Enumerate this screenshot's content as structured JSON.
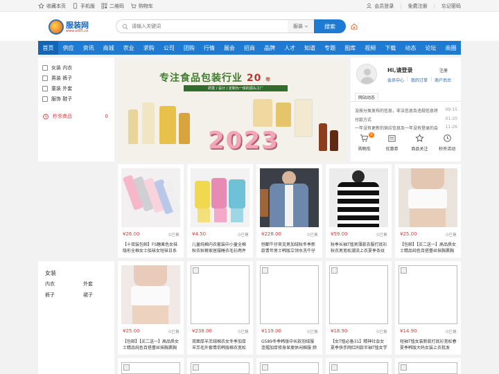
{
  "topbar": {
    "left": [
      {
        "icon": "star-icon",
        "label": "收藏本页"
      },
      {
        "icon": "mobile-icon",
        "label": "手机版"
      },
      {
        "icon": "qrcode-icon",
        "label": "二维码"
      },
      {
        "icon": "cart-icon",
        "label": "购物车"
      }
    ],
    "right": {
      "login_icon": "user-icon",
      "login": "会员登录",
      "register": "免费注册",
      "forgot": "忘记密码"
    }
  },
  "logo": {
    "title": "服装网",
    "url": "www.ef35.cn"
  },
  "search": {
    "placeholder": "请输入关键词",
    "category": "服装",
    "button": "搜索"
  },
  "nav": [
    "首页",
    "供应",
    "资讯",
    "商城",
    "农业",
    "求购",
    "公司",
    "团购",
    "行情",
    "展会",
    "招商",
    "品牌",
    "人才",
    "知道",
    "专题",
    "图库",
    "视频",
    "下载",
    "动态",
    "论坛",
    "商圈"
  ],
  "categories": [
    {
      "label": "女装 内衣"
    },
    {
      "label": "男装 裤子"
    },
    {
      "label": "童装 外套"
    },
    {
      "label": "服饰 鞋子"
    }
  ],
  "flash_sale": {
    "label": "秒杀商品",
    "count": "0"
  },
  "banner": {
    "title": "专注食品包装行业",
    "years": "20",
    "year_suffix": "年",
    "strip": "研发 / 设计 / 定制为一体的源头工厂",
    "year": "2023"
  },
  "user": {
    "greeting": "Hi,请登录",
    "register": "注册",
    "links": [
      "会员中心",
      "我的订单",
      "商户后台"
    ],
    "notice_tab": "网站动态",
    "notices": [
      {
        "text": "没按分类发布的信息，非法信息及违规信息将",
        "date": "09-15"
      },
      {
        "text": "付款方式",
        "date": "01-20"
      },
      {
        "text": "一年没有更新的供应信息及一年没有登录的会",
        "date": "11-26"
      }
    ],
    "quick": [
      {
        "icon": "cart-icon",
        "label": "购物车",
        "badge": "0"
      },
      {
        "icon": "coupon-icon",
        "label": "优惠券"
      },
      {
        "icon": "star-icon",
        "label": "商品关注"
      },
      {
        "icon": "clock-icon",
        "label": "秒杀活动"
      }
    ]
  },
  "side_category": {
    "title": "女装",
    "items": [
      "内衣",
      "外套",
      "裤子",
      "裙子"
    ]
  },
  "products_row1": [
    {
      "price": "¥26.00",
      "sold": "0已售",
      "name": "【十双装包邮】FS糖果色女袜隐形全棉女士船袜女短袜日系纯"
    },
    {
      "price": "¥4.50",
      "sold": "0已售",
      "name": "儿童纯棉内衣套装中小童全棉秋衣秋裤家居服睡衣毛衫两件套装"
    },
    {
      "price": "¥228.00",
      "sold": "0已售",
      "name": "刨都牛仔夹克男加绒秋冬季新款青年男士韩版立领水洗牛仔衣加"
    },
    {
      "price": "¥59.00",
      "sold": "0已售",
      "name": "秋季长袖T恤男薄款衣服打底衫秋衣男宽松潮流上衣夏季条纹男士"
    },
    {
      "price": "¥25.00",
      "sold": "0已售",
      "name": "【包邮】【买二送一】高品质女士精品纯色百搭蕾丝抹胸裹胸防走"
    }
  ],
  "products_row2": [
    {
      "price": "¥25.00",
      "sold": "0已售",
      "name": "【包邮】【买二送一】高品质女士精品纯色百搭蕾丝抹胸裹胸防走"
    },
    {
      "price": "¥238.00",
      "sold": "0已售",
      "name": "双面厚羊羔绒棉衣女冬季加厚羊羔毛外套情侣韩版棉衣宽松高领"
    },
    {
      "price": "¥119.00",
      "sold": "0已售",
      "name": "G589冬季韩版中长款羽绒服连帽加厚修身显瘦休闲棉服 颜色:"
    },
    {
      "price": "¥18.90",
      "sold": "0已售",
      "name": "【女T恤必备31】精神社会女夏季快手网红同款半袖T恤女学生"
    },
    {
      "price": "¥14.90",
      "sold": "0已售",
      "name": "短袖T恤女装新款打底衫宽松春夏季韩版大码女装上衣批发【买一送"
    }
  ],
  "colors": {
    "primary": "#1f7ad1",
    "price": "#e4393c",
    "link": "#1f63ad"
  }
}
